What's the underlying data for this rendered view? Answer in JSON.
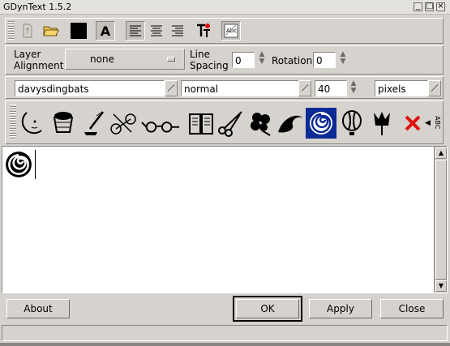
{
  "window": {
    "title": "GDynText 1.5.2"
  },
  "toolbar": {
    "icons": [
      "new-icon",
      "open-folder-icon",
      "color-swatch-icon",
      "antialias-icon",
      "align-left-icon",
      "align-center-icon",
      "align-right-icon",
      "text-tool-icon",
      "preview-icon"
    ],
    "color": "#000000"
  },
  "options": {
    "layer_alignment_label_1": "Layer",
    "layer_alignment_label_2": "Alignment",
    "layer_alignment_value": "none",
    "line_spacing_label_1": "Line",
    "line_spacing_label_2": "Spacing",
    "line_spacing_value": "0",
    "rotation_label": "Rotation",
    "rotation_value": "0"
  },
  "font": {
    "family": "davysdingbats",
    "style": "normal",
    "size": "40",
    "unit": "pixels"
  },
  "charmap": {
    "glyphs": [
      "moon",
      "basket",
      "quill",
      "bicycle",
      "spectacles",
      "book",
      "scissors",
      "flower",
      "wave",
      "rose",
      "balloon",
      "tulip"
    ],
    "selected_index": 9,
    "abc_label": "ABC"
  },
  "editor": {
    "content_glyph": "rose"
  },
  "buttons": {
    "about": "About",
    "ok": "OK",
    "apply": "Apply",
    "close": "Close"
  },
  "colors": {
    "selection": "#0b2a94",
    "delete": "#e01010"
  }
}
